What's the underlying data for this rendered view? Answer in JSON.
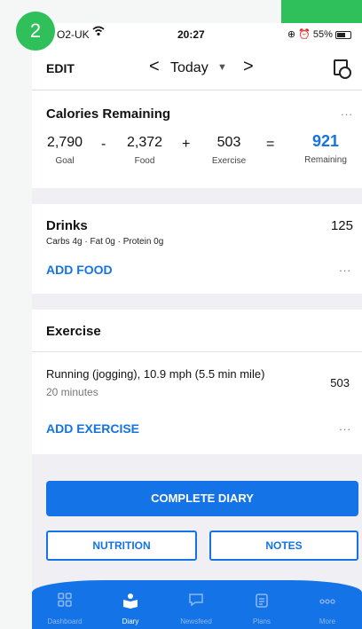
{
  "badge": "2",
  "status_bar": {
    "carrier": "O2-UK",
    "time": "20:27",
    "battery": "55%"
  },
  "nav": {
    "edit": "EDIT",
    "prev": "<",
    "date": "Today",
    "next": ">"
  },
  "calories": {
    "title": "Calories Remaining",
    "more": "...",
    "goal": "2,790",
    "goal_label": "Goal",
    "op1": "-",
    "food": "2,372",
    "food_label": "Food",
    "op2": "+",
    "exercise": "503",
    "exercise_label": "Exercise",
    "op3": "=",
    "remaining": "921",
    "remaining_label": "Remaining"
  },
  "drinks": {
    "title": "Drinks",
    "calories": "125",
    "macros": "Carbs 4g · Fat 0g · Protein 0g",
    "add": "ADD FOOD",
    "more": "..."
  },
  "exercise": {
    "title": "Exercise",
    "item_name": "Running (jogging), 10.9 mph (5.5 min mile)",
    "item_duration": "20 minutes",
    "item_calories": "503",
    "add": "ADD EXERCISE",
    "more": "..."
  },
  "buttons": {
    "complete": "COMPLETE DIARY",
    "nutrition": "NUTRITION",
    "notes": "NOTES"
  },
  "tabs": [
    {
      "label": "Dashboard",
      "icon": "grid-icon"
    },
    {
      "label": "Diary",
      "icon": "book-icon"
    },
    {
      "label": "Newsfeed",
      "icon": "chat-icon"
    },
    {
      "label": "Plans",
      "icon": "clipboard-icon"
    },
    {
      "label": "More",
      "icon": "more-icon"
    }
  ],
  "colors": {
    "accent": "#1473e6",
    "badge": "#2fbf5b"
  }
}
